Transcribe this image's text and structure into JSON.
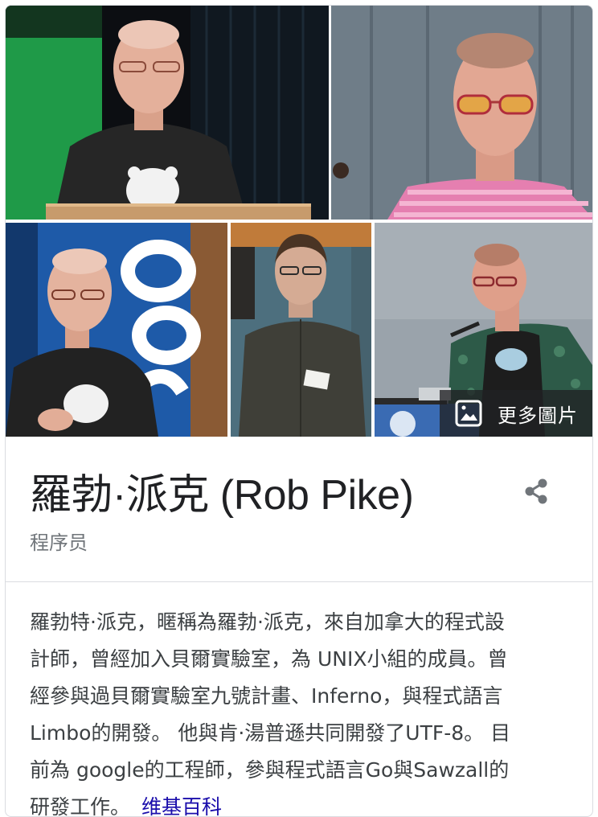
{
  "knowledge_panel": {
    "photos": [
      {
        "name": "photo-rob-pike-gopher-podium"
      },
      {
        "name": "photo-rob-pike-glasses-pink-shirt"
      },
      {
        "name": "photo-rob-pike-oscon"
      },
      {
        "name": "photo-man-dark-shirt"
      },
      {
        "name": "photo-rob-pike-lectern"
      }
    ],
    "more_images_label": "更多圖片",
    "more_images_icon": "image-icon",
    "title": "羅勃·派克 (Rob Pike)",
    "subtitle": "程序员",
    "share_icon": "share-icon",
    "description_lines": [
      "羅勃特·派克，暱稱為羅勃·派克，來自加拿大的程式設",
      "計師，曾經加入貝爾實驗室，為 UNIX小組的成員。曾",
      "經參與過貝爾實驗室九號計畫、Inferno，與程式語言",
      "Limbo的開發。 他與肯·湯普遜共同開發了UTF-8。 目",
      "前為 google的工程師，參與程式語言Go與Sawzall的",
      "研發工作。"
    ],
    "source_link": "维基百科"
  },
  "colors": {
    "link": "#1a0dab",
    "title": "#202124",
    "subtitle": "#70757a",
    "body_text": "#3c4043",
    "border": "#dadce0"
  }
}
